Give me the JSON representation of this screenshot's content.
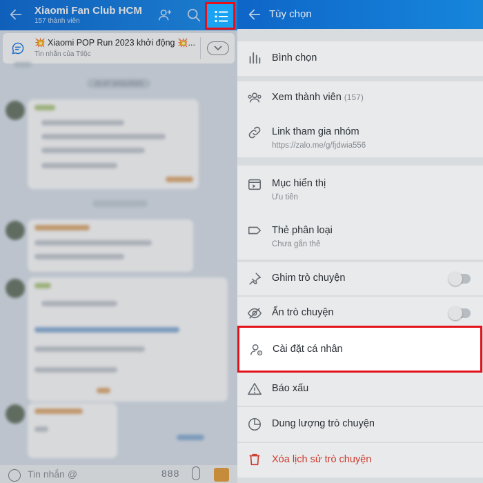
{
  "chat": {
    "group_name": "Xiaomi Fan Club HCM ...",
    "member_count_text": "157 thành viên",
    "pinned_message": {
      "title": "💥 Xiaomi POP Run 2023 khởi động 💥...",
      "subtitle": "Tin nhắn của Ttlộc"
    },
    "date_tag": "21:47 10/11/2023",
    "composer_placeholder": "Tin nhắn @",
    "more_dots": "888"
  },
  "options": {
    "title": "Tùy chọn",
    "items": [
      {
        "icon": "poll-icon",
        "label": "Bình chọn",
        "sub": ""
      },
      {
        "icon": "members-icon",
        "label": "Xem thành viên",
        "count": "(157)",
        "sub": ""
      },
      {
        "icon": "link-icon",
        "label": "Link tham gia nhóm",
        "sub": "https://zalo.me/g/fjdwia556"
      },
      {
        "icon": "display-section-icon",
        "label": "Mục hiển thị",
        "sub": "Ưu tiên"
      },
      {
        "icon": "label-tag-icon",
        "label": "Thẻ phân loại",
        "sub": "Chưa gắn thẻ"
      },
      {
        "icon": "pin-icon",
        "label": "Ghim trò chuyện",
        "sub": "",
        "toggle": false
      },
      {
        "icon": "hide-eye-icon",
        "label": "Ẩn trò chuyện",
        "sub": "",
        "toggle": false
      },
      {
        "icon": "personal-settings-icon",
        "label": "Cài đặt cá nhân",
        "sub": ""
      },
      {
        "icon": "warning-icon",
        "label": "Báo xấu",
        "sub": ""
      },
      {
        "icon": "storage-pie-icon",
        "label": "Dung lượng trò chuyện",
        "sub": ""
      },
      {
        "icon": "trash-icon",
        "label": "Xóa lịch sử trò chuyện",
        "sub": ""
      }
    ]
  },
  "colors": {
    "header_blue": "#0c6cd8",
    "highlight_red": "#e3111a",
    "danger_red": "#e03b2e"
  }
}
